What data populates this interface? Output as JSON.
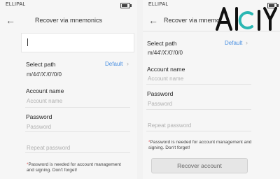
{
  "status": {
    "carrier": "ELLIPAL"
  },
  "left": {
    "title": "Recover via mnemonics",
    "select_path_label": "Select path",
    "default_link": "Default",
    "path_value": "m/44'/X'/0'/0/0",
    "account_name_label": "Account name",
    "account_name_placeholder": "Account name",
    "password_label": "Password",
    "password_placeholder": "Password",
    "repeat_password_placeholder": "Repeat password",
    "note": "Password is needed for account management and signing. Don't forget!"
  },
  "right": {
    "title": "Recover via mnemo",
    "select_path_label": "Select path",
    "default_link": "Default",
    "path_value": "m/44'/X'/0'/0/0",
    "account_name_label": "Account name",
    "account_name_placeholder": "Account name",
    "password_label": "Password",
    "password_placeholder": "Password",
    "repeat_password_placeholder": "Repeat password",
    "note": "Password is needed for account management and signing. Don't forget!",
    "recover_button": "Recover account"
  },
  "watermark": {
    "text": "Alc1Y",
    "color": "#111111",
    "accent": "#2bb7b3"
  },
  "colors": {
    "link": "#4a90e2",
    "warning_star": "#e05a5a"
  },
  "icons": {
    "back": "arrow-left-icon",
    "chevron": "chevron-right-icon",
    "battery": "battery-icon"
  }
}
